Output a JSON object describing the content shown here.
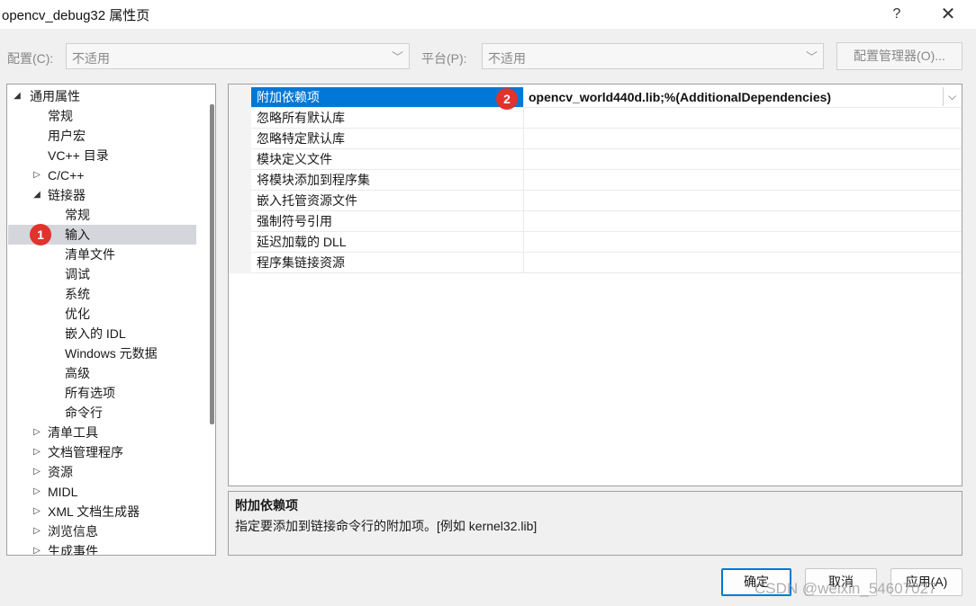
{
  "window": {
    "title": "opencv_debug32 属性页",
    "help": "?",
    "close": "✕"
  },
  "toolbar": {
    "config_label": "配置(C):",
    "config_value": "不适用",
    "platform_label": "平台(P):",
    "platform_value": "不适用",
    "config_manager": "配置管理器(O)..."
  },
  "tree": {
    "items": [
      {
        "label": "通用属性",
        "expander": "◢"
      },
      {
        "label": "常规"
      },
      {
        "label": "用户宏"
      },
      {
        "label": "VC++ 目录"
      },
      {
        "label": "C/C++",
        "expander": "▷"
      },
      {
        "label": "链接器",
        "expander": "◢"
      },
      {
        "label": "常规"
      },
      {
        "label": "输入"
      },
      {
        "label": "清单文件"
      },
      {
        "label": "调试"
      },
      {
        "label": "系统"
      },
      {
        "label": "优化"
      },
      {
        "label": "嵌入的 IDL"
      },
      {
        "label": "Windows 元数据"
      },
      {
        "label": "高级"
      },
      {
        "label": "所有选项"
      },
      {
        "label": "命令行"
      },
      {
        "label": "清单工具",
        "expander": "▷"
      },
      {
        "label": "文档管理程序",
        "expander": "▷"
      },
      {
        "label": "资源",
        "expander": "▷"
      },
      {
        "label": "MIDL",
        "expander": "▷"
      },
      {
        "label": "XML 文档生成器",
        "expander": "▷"
      },
      {
        "label": "浏览信息",
        "expander": "▷"
      },
      {
        "label": "生成事件",
        "expander": "▷"
      }
    ],
    "marker": "1"
  },
  "grid": {
    "rows": [
      {
        "name": "附加依赖项",
        "value": "opencv_world440d.lib;%(AdditionalDependencies)"
      },
      {
        "name": "忽略所有默认库",
        "value": ""
      },
      {
        "name": "忽略特定默认库",
        "value": ""
      },
      {
        "name": "模块定义文件",
        "value": ""
      },
      {
        "name": "将模块添加到程序集",
        "value": ""
      },
      {
        "name": "嵌入托管资源文件",
        "value": ""
      },
      {
        "name": "强制符号引用",
        "value": ""
      },
      {
        "name": "延迟加载的 DLL",
        "value": ""
      },
      {
        "name": "程序集链接资源",
        "value": ""
      }
    ],
    "marker": "2",
    "dropdown_icon": "⌵"
  },
  "description": {
    "title": "附加依赖项",
    "text": "指定要添加到链接命令行的附加项。[例如 kernel32.lib]"
  },
  "buttons": {
    "ok": "确定",
    "cancel": "取消",
    "apply": "应用(A)"
  },
  "watermark": "CSDN @weixin_54607027",
  "colors": {
    "selection": "#0078d7",
    "tree_selection": "#d5d5dc",
    "marker": "#e0332c"
  }
}
